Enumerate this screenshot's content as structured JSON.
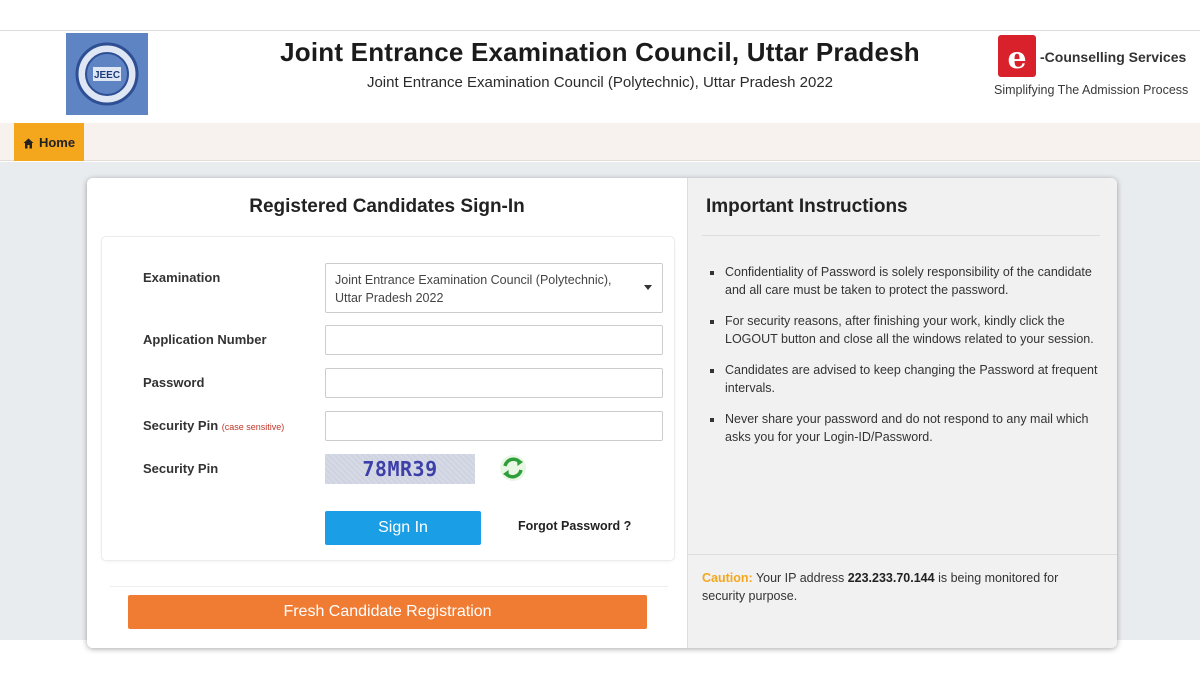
{
  "header": {
    "title": "Joint Entrance Examination Council, Uttar Pradesh",
    "subtitle": "Joint Entrance Examination Council (Polytechnic), Uttar Pradesh 2022",
    "left_logo_text": "JEEC",
    "ecs_label": "-Counselling Services",
    "ecs_tagline": "Simplifying The Admission Process"
  },
  "nav": {
    "home_label": "Home"
  },
  "signin": {
    "title": "Registered Candidates Sign-In",
    "examination_label": "Examination",
    "examination_value": "Joint Entrance Examination Council (Polytechnic), Uttar Pradesh 2022",
    "application_label": "Application Number",
    "application_value": "",
    "password_label": "Password",
    "password_value": "",
    "pin_label": "Security Pin",
    "pin_hint": "(case sensitive)",
    "pin_value": "",
    "captcha_label": "Security Pin",
    "captcha_text": "78MR39",
    "signin_button": "Sign In",
    "forgot_link": "Forgot Password ?",
    "fresh_button": "Fresh Candidate Registration"
  },
  "instructions": {
    "title": "Important Instructions",
    "items": [
      "Confidentiality of Password is solely responsibility of the candidate and all care must be taken to protect the password.",
      "For security reasons, after finishing your work, kindly click the LOGOUT button and close all the windows related to your session.",
      "Candidates are advised to keep changing the Password at frequent intervals.",
      "Never share your password and do not respond to any mail which asks you for your Login-ID/Password."
    ],
    "caution_word": "Caution:",
    "caution_pre": "Your IP address",
    "caution_ip": "223.233.70.144",
    "caution_post": "is being monitored for security purpose."
  },
  "colors": {
    "nav_home": "#f4a71d",
    "signin_button": "#1a9fe6",
    "fresh_button": "#f07c34",
    "brand_red": "#d8212b"
  },
  "icons": [
    "jeec-logo-icon",
    "home-icon",
    "dropdown-caret-icon",
    "refresh-icon",
    "ecs-logo-icon"
  ]
}
